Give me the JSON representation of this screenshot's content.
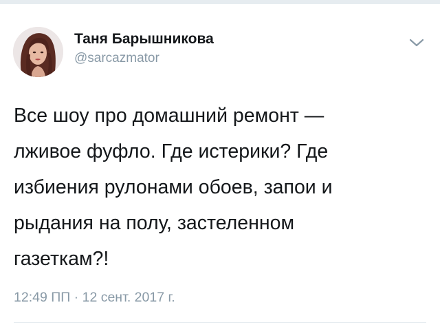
{
  "tweet": {
    "author": {
      "display_name": "Таня Барышникова",
      "handle": "@sarcazmator"
    },
    "text": "Все шоу про домашний ремонт —\nлживое фуфло. Где истерики? Где\nизбиения рулонами обоев, запои и\nрыдания на полу, застеленном\nгазеткам?!",
    "meta": {
      "time": "12:49 ПП",
      "separator": "·",
      "date": "12 сент. 2017 г."
    },
    "icons": {
      "menu": "chevron-down-icon",
      "avatar": "profile-photo"
    }
  },
  "colors": {
    "text": "#14171a",
    "secondary_text": "#8899a6",
    "divider": "#e6ecf0",
    "background": "#ffffff"
  }
}
